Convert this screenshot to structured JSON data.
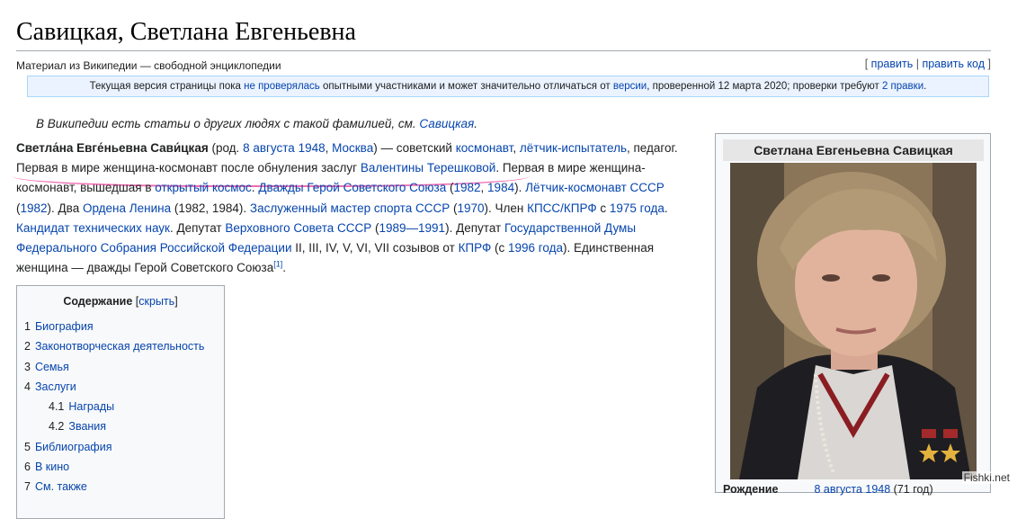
{
  "page": {
    "title": "Савицкая, Светлана Евгеньевна",
    "tagline": "Материал из Википедии — свободной энциклопедии"
  },
  "edit_links": {
    "open": "[",
    "edit": "править",
    "sep": "|",
    "edit_code": "править код",
    "close": "]"
  },
  "review_notice": {
    "t1": "Текущая версия страницы пока ",
    "l1": "не проверялась",
    "t2": " опытными участниками и может значительно отличаться от ",
    "l2": "версии",
    "t3": ", проверенной 12 марта 2020; проверки требуют ",
    "l3": "2 правки",
    "t4": "."
  },
  "hatnote": {
    "text": "В Википедии есть статьи о других людях с такой фамилией, см. ",
    "link": "Савицкая",
    "end": "."
  },
  "article": {
    "name": "Светла́на Евге́ньевна Сави́цкая",
    "t_rod": " (род. ",
    "l_date": "8 августа 1948",
    "t_comma": ", ",
    "l_city": "Москва",
    "t_close": ") — советский ",
    "l_cosmonaut": "космонавт",
    "t_c1": ", ",
    "l_pilot": "лётчик-испытатель",
    "t_teacher": ", педагог. Первая в мире женщина-космонавт после обнуления заслуг ",
    "l_tereshkova": "Валентины Терешковой",
    "t_first": ". Первая в мире женщина-космонавт, вышедшая в ",
    "l_space": "открытый космос",
    "t_dot1": ". ",
    "l_hero": "Дважды Герой Советского Союза",
    "t_par1": " (",
    "l_1982a": "1982",
    "t_c2": ", ",
    "l_1984": "1984",
    "t_par2": "). ",
    "l_pilotcosm": "Лётчик-космонавт СССР",
    "t_par3": " (",
    "l_1982b": "1982",
    "t_two": "). Два ",
    "l_lenin": "Ордена Ленина",
    "t_years": " (1982, 1984). ",
    "l_master": "Заслуженный мастер спорта СССР",
    "t_par4": " (",
    "l_1970": "1970",
    "t_member": "). Член ",
    "l_kpss": "КПСС/КПРФ",
    "t_s": " с ",
    "l_1975": "1975 года",
    "t_dot2": ". ",
    "l_candidate": "Кандидат технических наук",
    "t_deputy": ". Депутат ",
    "l_supreme": "Верховного Совета СССР",
    "t_par5": " (",
    "l_1989": "1989—1991",
    "t_deputy2": "). Депутат ",
    "l_duma": "Государственной Думы Федерального Собрания Российской Федерации",
    "t_conv": " II, III, IV, V, VI, VII созывов от ",
    "l_kprf": "КПРФ",
    "t_par6": " (с ",
    "l_1996": "1996 года",
    "t_only": "). Единственная женщина — дважды Герой Советского Союза",
    "ref": "[1]",
    "t_end": "."
  },
  "toc": {
    "title": "Содержание",
    "toggle_open": " [",
    "toggle": "скрыть",
    "toggle_close": "]",
    "items": [
      {
        "num": "1",
        "label": "Биография"
      },
      {
        "num": "2",
        "label": "Законотворческая деятельность"
      },
      {
        "num": "3",
        "label": "Семья"
      },
      {
        "num": "4",
        "label": "Заслуги"
      },
      {
        "num": "4.1",
        "label": "Награды"
      },
      {
        "num": "4.2",
        "label": "Звания"
      },
      {
        "num": "5",
        "label": "Библиография"
      },
      {
        "num": "6",
        "label": "В кино"
      },
      {
        "num": "7",
        "label": "См. также"
      }
    ]
  },
  "infobox": {
    "title": "Светлана Евгеньевна Савицкая",
    "birth_label": "Рождение",
    "birth_date": "8 августа 1948",
    "birth_age": " (71 год)"
  },
  "watermark": "Fishki.net",
  "colors": {
    "link": "#0645ad",
    "highlight_underline": "#f06bb1",
    "notice_bg": "#eaf3ff",
    "infobox_bg": "#f8f9fa"
  }
}
